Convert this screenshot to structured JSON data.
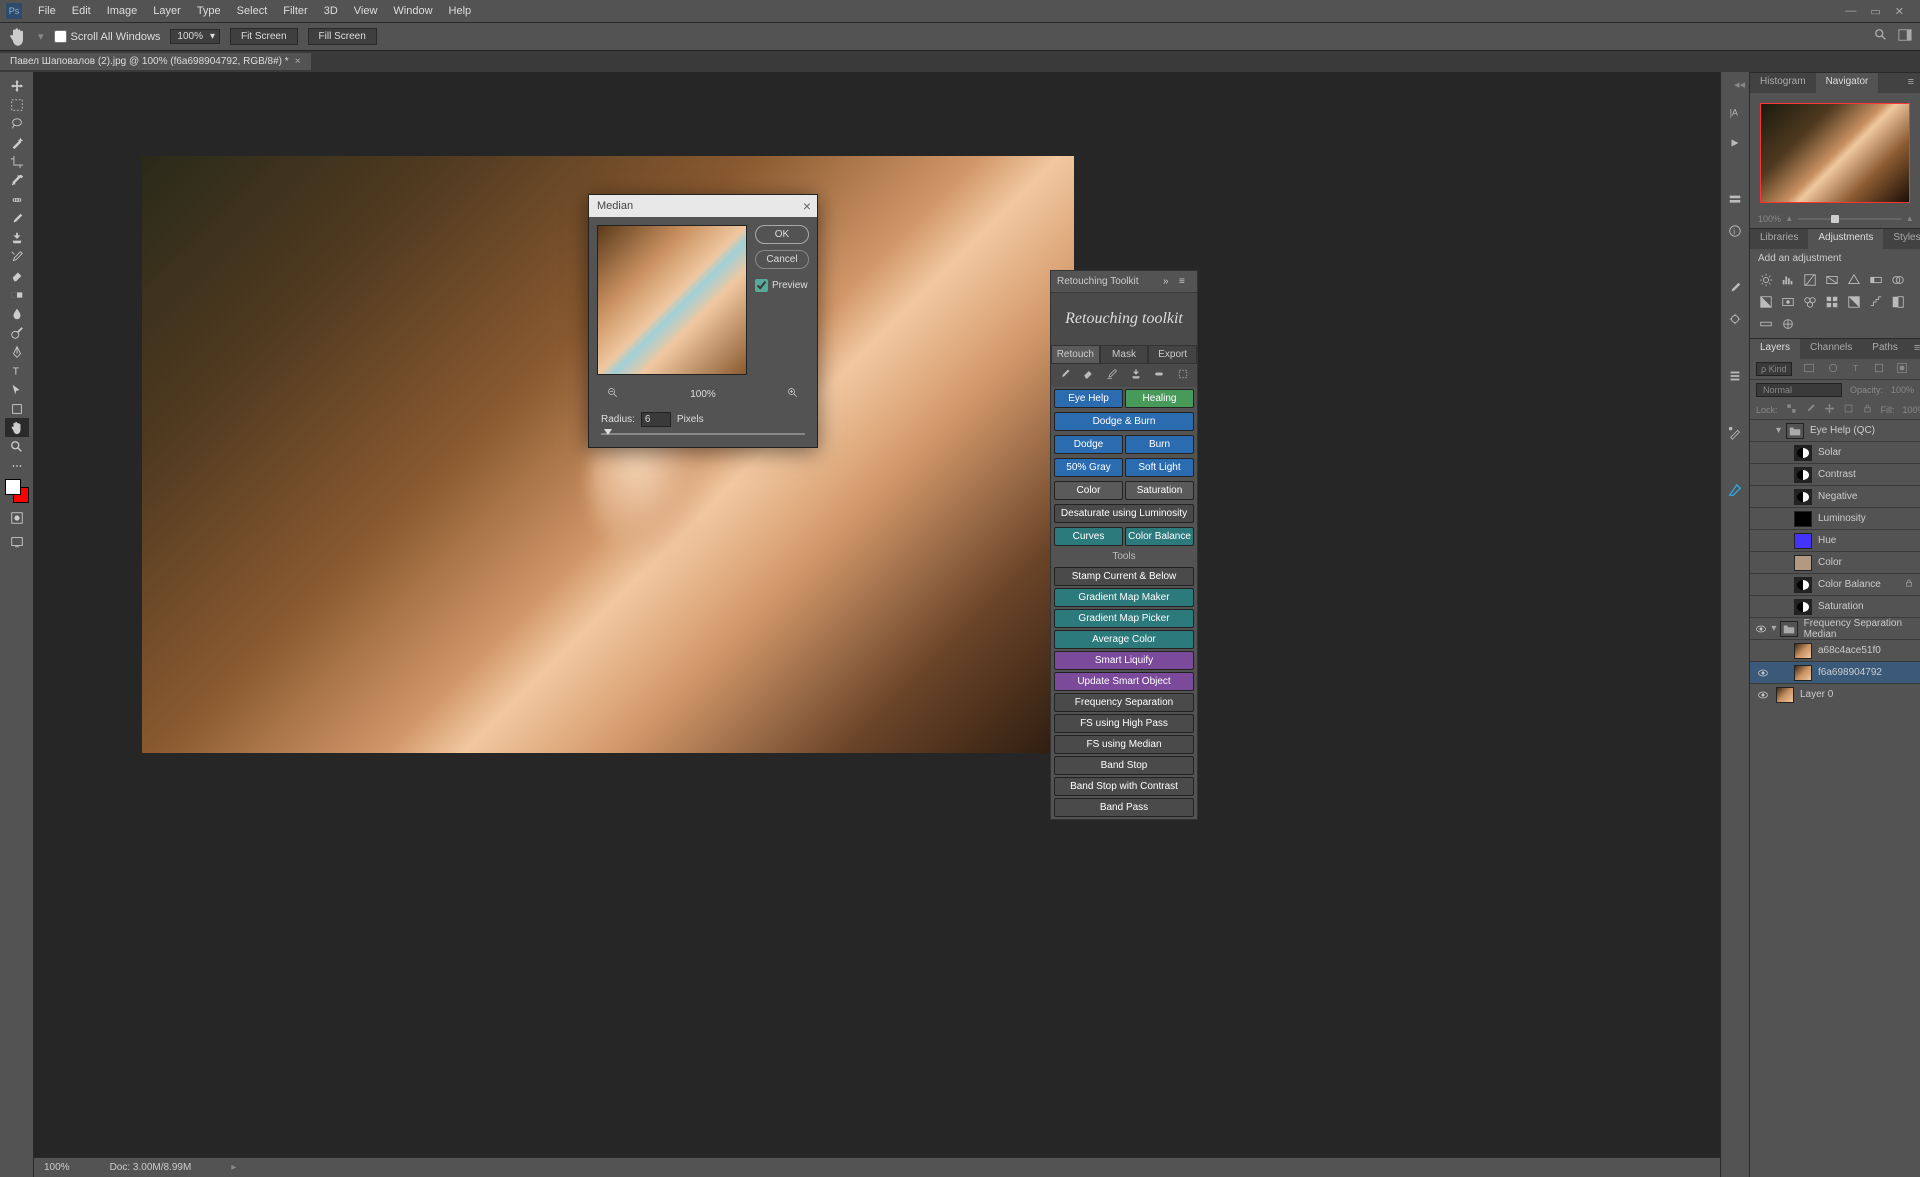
{
  "menubar": {
    "items": [
      "File",
      "Edit",
      "Image",
      "Layer",
      "Type",
      "Select",
      "Filter",
      "3D",
      "View",
      "Window",
      "Help"
    ]
  },
  "optionsbar": {
    "scroll_all": "Scroll All Windows",
    "zoom": "100%",
    "fit": "Fit Screen",
    "fill": "Fill Screen"
  },
  "doctab": "Павел Шаповалов (2).jpg @ 100% (f6a698904792, RGB/8#) *",
  "statusbar": {
    "zoom": "100%",
    "doc": "Doc: 3.00M/8.99M"
  },
  "dialog": {
    "title": "Median",
    "ok": "OK",
    "cancel": "Cancel",
    "preview": "Preview",
    "zoom": "100%",
    "radius_label": "Radius:",
    "radius": "6",
    "pixels": "Pixels"
  },
  "rt": {
    "title": "Retouching Toolkit",
    "logo": "Retouching toolkit",
    "tabs": [
      "Retouch",
      "Mask",
      "Export"
    ],
    "buttons": {
      "eyehelp": "Eye Help",
      "healing": "Healing",
      "dodgeburn": "Dodge & Burn",
      "dodge": "Dodge",
      "burn": "Burn",
      "fifty": "50% Gray",
      "soft": "Soft Light",
      "color": "Color",
      "sat": "Saturation",
      "desat": "Desaturate using Luminosity",
      "curves": "Curves",
      "cbal": "Color Balance",
      "stamp": "Stamp Current & Below",
      "gmm": "Gradient Map Maker",
      "gmp": "Gradient Map Picker",
      "avg": "Average Color",
      "liq": "Smart Liquify",
      "uso": "Update Smart Object",
      "fs": "Frequency Separation",
      "fshp": "FS using High Pass",
      "fsm": "FS using Median",
      "bs": "Band Stop",
      "bsc": "Band Stop with Contrast",
      "bp": "Band Pass"
    },
    "tools_label": "Tools"
  },
  "rightpanels": {
    "nav_tabs": [
      "Histogram",
      "Navigator"
    ],
    "nav_zoom": "100%",
    "adj_tabs": [
      "Libraries",
      "Adjustments",
      "Styles"
    ],
    "adj_label": "Add an adjustment",
    "layer_tabs": [
      "Layers",
      "Channels",
      "Paths"
    ],
    "blend_mode": "Normal",
    "opacity_label": "Opacity:",
    "opacity": "100%",
    "lock_label": "Lock:",
    "fill_label": "Fill:",
    "fill": "100%",
    "kind": "ρ Kind"
  },
  "layers": [
    {
      "type": "group",
      "name": "Eye Help (QC)",
      "vis": false,
      "chev": "▾"
    },
    {
      "type": "adj",
      "name": "Solar",
      "thumb": "circle",
      "indent": 1
    },
    {
      "type": "adj",
      "name": "Contrast",
      "thumb": "circle",
      "indent": 1
    },
    {
      "type": "adj",
      "name": "Negative",
      "thumb": "circle",
      "indent": 1
    },
    {
      "type": "adj",
      "name": "Luminosity",
      "thumb": "dark",
      "indent": 1
    },
    {
      "type": "adj",
      "name": "Hue",
      "thumb": "blue",
      "indent": 1
    },
    {
      "type": "adj",
      "name": "Color",
      "thumb": "tan",
      "indent": 1
    },
    {
      "type": "adj",
      "name": "Color Balance",
      "thumb": "circle",
      "indent": 1,
      "locked": true
    },
    {
      "type": "adj",
      "name": "Saturation",
      "thumb": "circle",
      "indent": 1
    },
    {
      "type": "group",
      "name": "Frequency Separation Median",
      "vis": true,
      "chev": "▾"
    },
    {
      "type": "img",
      "name": "a68c4ace51f0",
      "indent": 1
    },
    {
      "type": "img",
      "name": "f6a698904792",
      "indent": 1,
      "vis": true,
      "selected": true
    },
    {
      "type": "img",
      "name": "Layer 0",
      "vis": true
    }
  ]
}
